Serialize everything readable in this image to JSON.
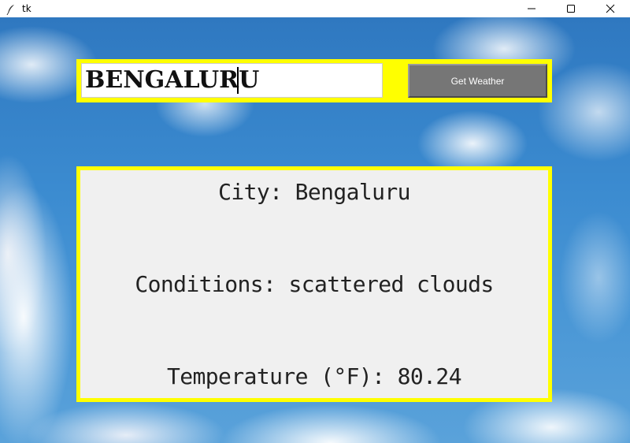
{
  "window": {
    "title": "tk",
    "controls": [
      "minimize",
      "maximize",
      "close"
    ]
  },
  "search": {
    "value": "BENGALURU",
    "button_label": "Get Weather"
  },
  "result": {
    "line_city": "City: Bengaluru",
    "line_conditions": "Conditions: scattered clouds",
    "line_temperature": "Temperature (°F): 80.24"
  },
  "colors": {
    "frame_accent": "#ffff00",
    "button_bg": "#767676",
    "panel_bg": "#f0f0f0",
    "sky": "#3b8bd0"
  },
  "icons": {
    "app": "feather-icon",
    "minimize": "minimize-icon",
    "maximize": "maximize-icon",
    "close": "close-icon"
  }
}
